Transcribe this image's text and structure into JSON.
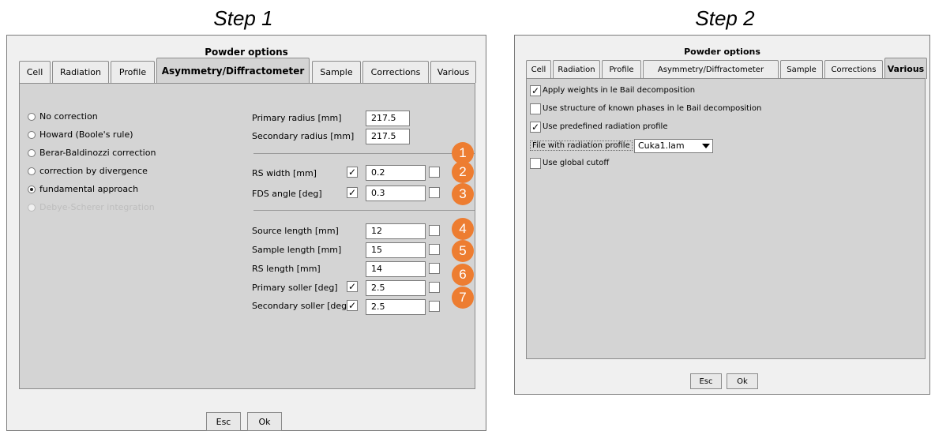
{
  "step1": {
    "heading": "Step 1",
    "dialog_title": "Powder options",
    "tabs": [
      "Cell",
      "Radiation",
      "Profile",
      "Asymmetry/Diffractometer",
      "Sample",
      "Corrections",
      "Various"
    ],
    "active_tab": "Asymmetry/Diffractometer",
    "radios": [
      {
        "label": "No correction",
        "selected": false,
        "enabled": true
      },
      {
        "label": "Howard (Boole's rule)",
        "selected": false,
        "enabled": true
      },
      {
        "label": "Berar-Baldinozzi correction",
        "selected": false,
        "enabled": true
      },
      {
        "label": "correction by divergence",
        "selected": false,
        "enabled": true
      },
      {
        "label": "fundamental approach",
        "selected": true,
        "enabled": true
      },
      {
        "label": "Debye-Scherer integration",
        "selected": false,
        "enabled": false
      }
    ],
    "fields": {
      "primary_radius": {
        "label": "Primary radius [mm]",
        "value": "217.5"
      },
      "secondary_radius": {
        "label": "Secondary radius [mm]",
        "value": "217.5"
      },
      "rs_width": {
        "label": "RS width [mm]",
        "value": "0.2",
        "checked": true
      },
      "fds_angle": {
        "label": "FDS angle [deg]",
        "value": "0.3",
        "checked": true
      },
      "source_length": {
        "label": "Source length [mm]",
        "value": "12"
      },
      "sample_length": {
        "label": "Sample length [mm]",
        "value": "15"
      },
      "rs_length": {
        "label": "RS length [mm]",
        "value": "14"
      },
      "primary_soller": {
        "label": "Primary soller [deg]",
        "value": "2.5",
        "checked": true
      },
      "secondary_soller": {
        "label": "Secondary soller [deg]",
        "value": "2.5",
        "checked": true
      }
    },
    "badges": [
      "1",
      "2",
      "3",
      "4",
      "5",
      "6",
      "7"
    ],
    "buttons": {
      "esc": "Esc",
      "ok": "Ok"
    }
  },
  "step2": {
    "heading": "Step 2",
    "dialog_title": "Powder options",
    "tabs": [
      "Cell",
      "Radiation",
      "Profile",
      "Asymmetry/Diffractometer",
      "Sample",
      "Corrections",
      "Various"
    ],
    "active_tab": "Various",
    "options": [
      {
        "label": "Apply weights in le Bail decomposition",
        "checked": true
      },
      {
        "label": "Use structure of known phases in le Bail decomposition",
        "checked": false
      },
      {
        "label": "Use predefined radiation profile",
        "checked": true
      },
      {
        "label": "Use global cutoff",
        "checked": false
      }
    ],
    "file_label": "File with radiation profile",
    "file_value": "Cuka1.lam",
    "buttons": {
      "esc": "Esc",
      "ok": "Ok"
    }
  },
  "colors": {
    "badge": "#ed7d31",
    "panel": "#d4d4d4",
    "dialog": "#f0f0f0"
  }
}
